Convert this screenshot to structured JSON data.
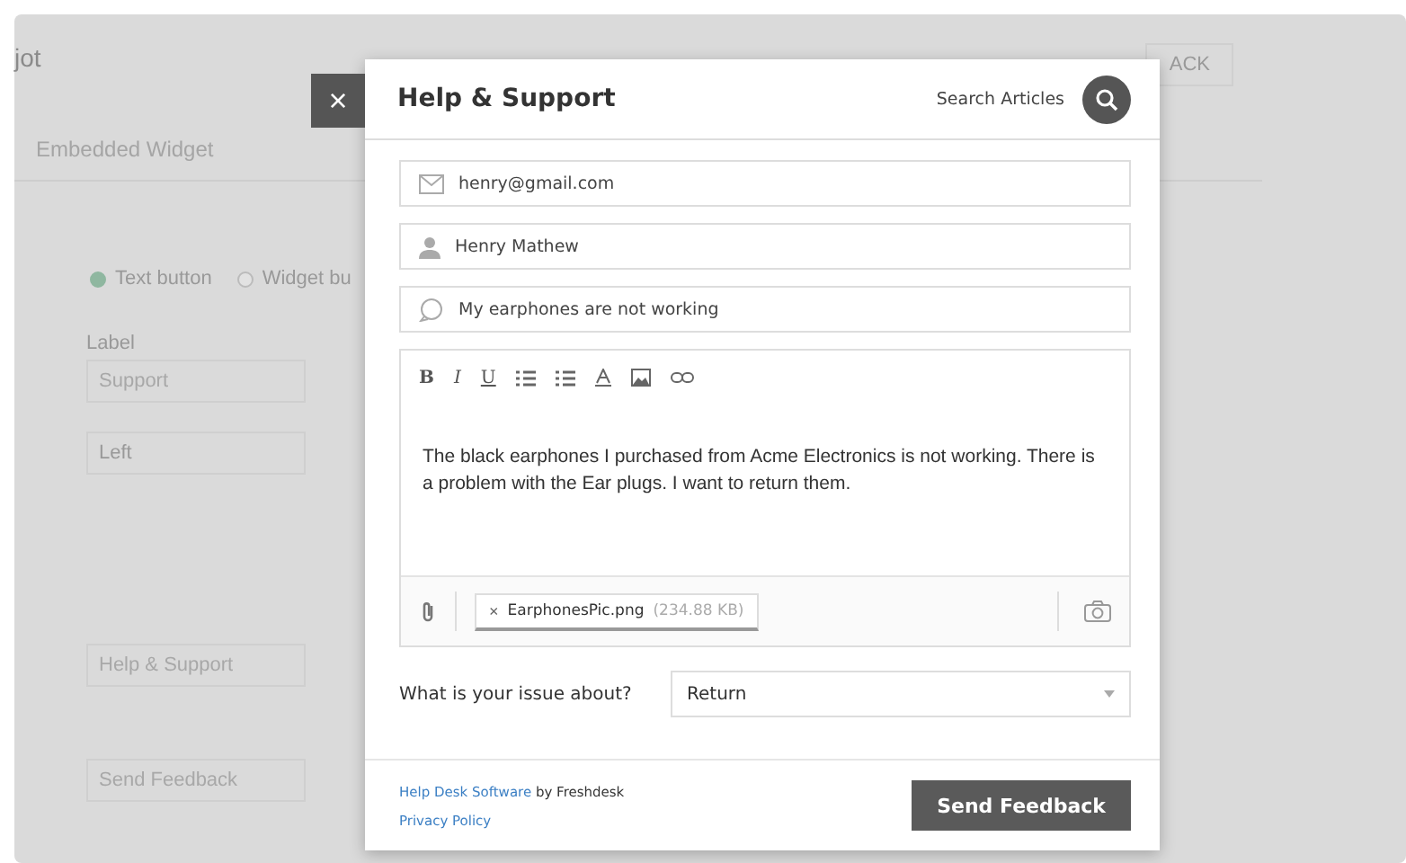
{
  "background": {
    "title": "jot",
    "tab": "Embedded Widget",
    "back_button": "ACK",
    "button_types": [
      {
        "label": "Text button",
        "selected": true
      },
      {
        "label": "Widget bu",
        "selected": false
      }
    ],
    "label_heading": "Label",
    "label_value": "Support",
    "position_value": "Left",
    "text_fields": [
      "Help & Support",
      "Send Feedback"
    ]
  },
  "dialog": {
    "close": "×",
    "title": "Help & Support",
    "search_label": "Search Articles",
    "email": "henry@gmail.com",
    "name": "Henry Mathew",
    "subject": "My earphones are not working",
    "format_buttons": [
      {
        "kind": "bold",
        "label": "B"
      },
      {
        "kind": "italic",
        "label": "I"
      },
      {
        "kind": "underline",
        "label": "U"
      }
    ],
    "message": "The black earphones I purchased from Acme Electronics is not working. There is a problem with the Ear plugs. I want to return them.",
    "attachment": {
      "remove": "×",
      "name": "EarphonesPic.png",
      "size": "(234.88 KB)"
    },
    "issue_label": "What is your issue about?",
    "issue_value": "Return",
    "footer_link": "Help Desk Software",
    "footer_by": "by Freshdesk",
    "privacy": "Privacy Policy",
    "submit": "Send Feedback"
  }
}
